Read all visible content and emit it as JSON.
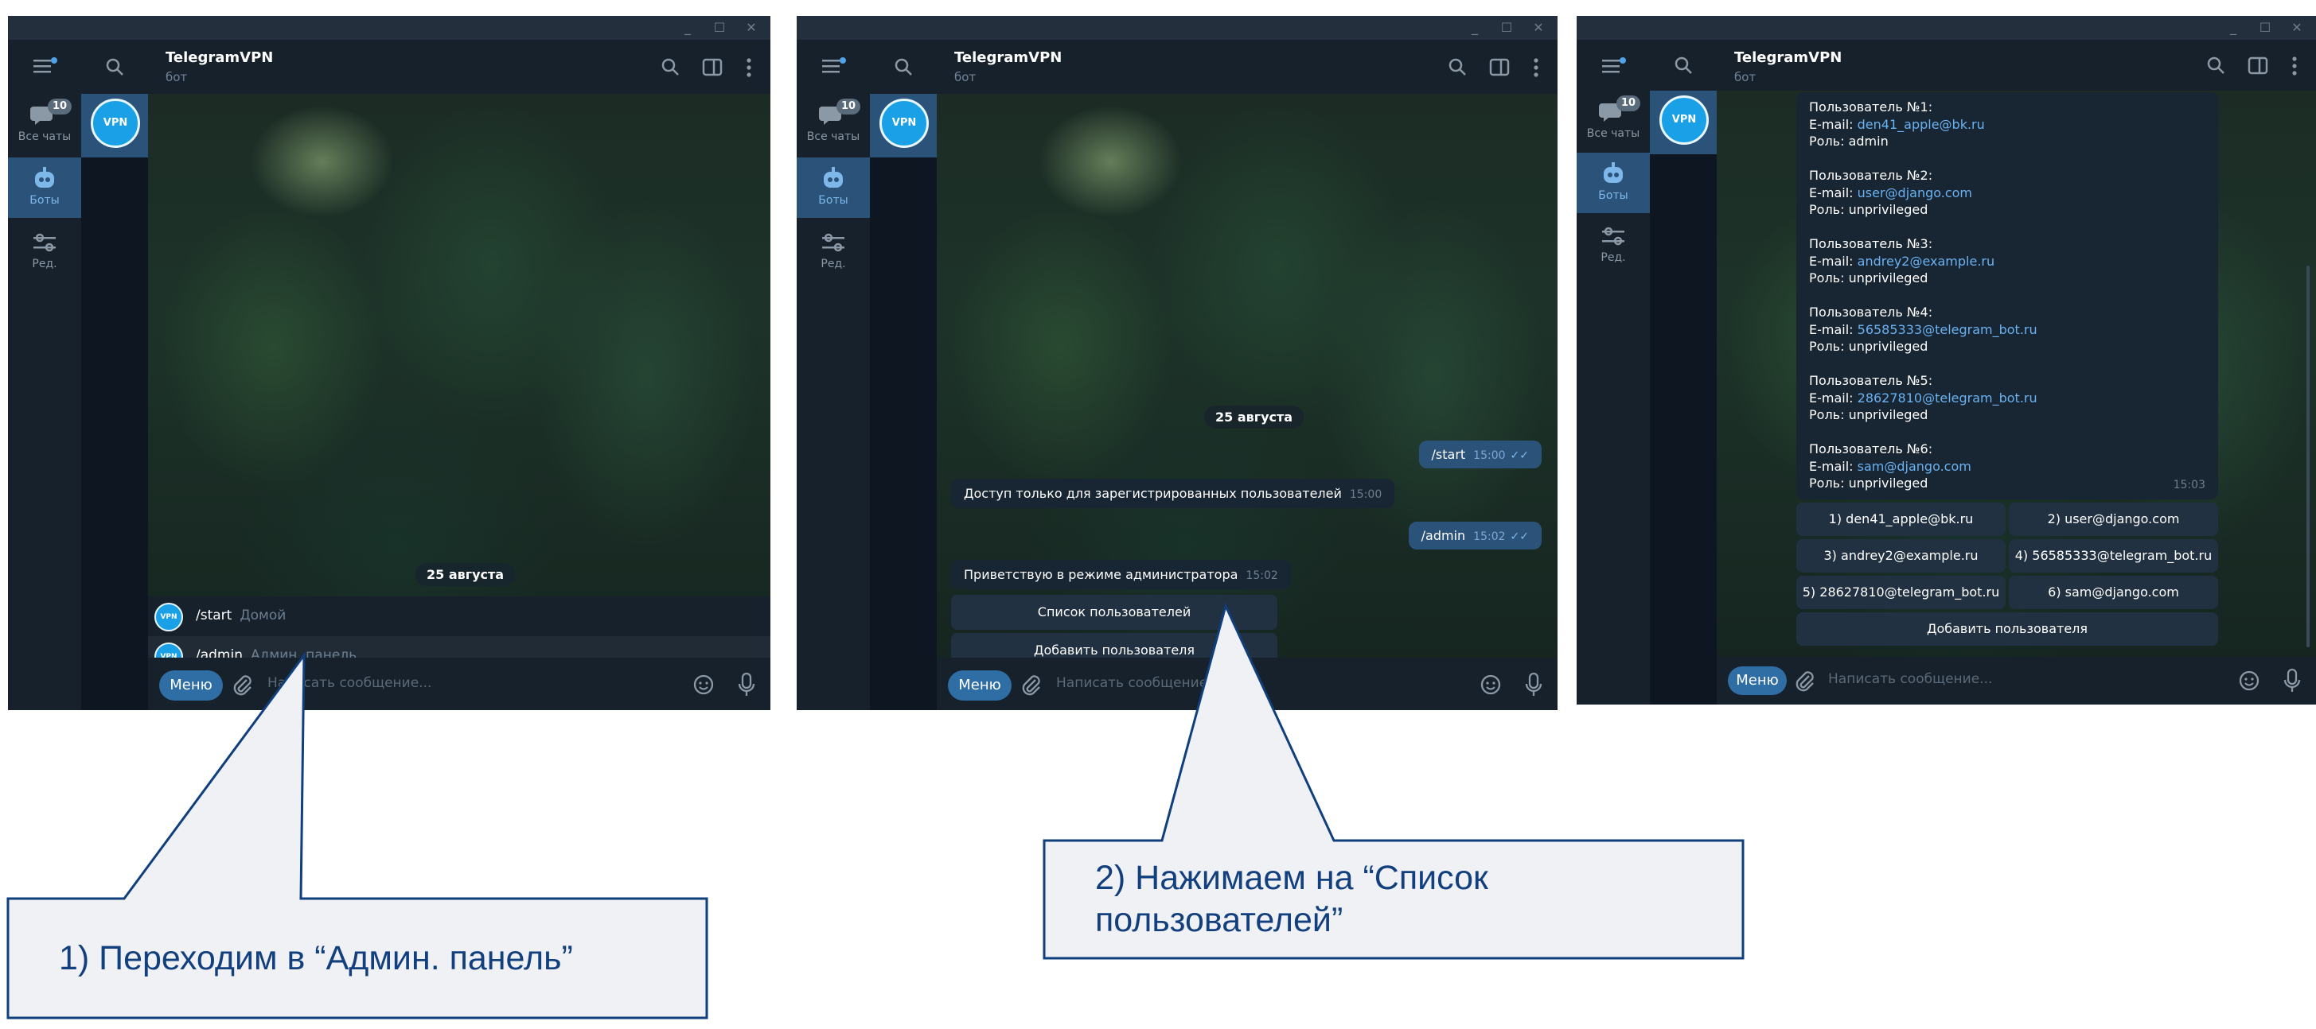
{
  "window": {
    "title": "TelegramVPN",
    "subtitle": "бот"
  },
  "rail": {
    "all_chats": "Все чаты",
    "all_chats_badge": "10",
    "bots": "Боты",
    "edit": "Ред."
  },
  "avatar_text": "VPN",
  "composer": {
    "menu": "Меню",
    "placeholder": "Написать сообщение..."
  },
  "date": "25 августа",
  "screen1": {
    "commands": [
      {
        "cmd": "/start",
        "desc": "Домой"
      },
      {
        "cmd": "/admin",
        "desc": "Админ. панель"
      }
    ]
  },
  "screen2": {
    "messages": [
      {
        "text": "/start",
        "time": "15:00"
      },
      {
        "text": "Доступ только для зарегистрированных пользователей",
        "time": "15:00"
      },
      {
        "text": "/admin",
        "time": "15:02"
      },
      {
        "text": "Приветствую в режиме администратора",
        "time": "15:02"
      }
    ],
    "buttons": [
      "Список пользователей",
      "Добавить пользователя"
    ]
  },
  "screen3": {
    "users": [
      {
        "title": "Пользователь №1:",
        "email_label": "E-mail: ",
        "email": "den41_apple@bk.ru",
        "role": "Роль: admin"
      },
      {
        "title": "Пользователь №2:",
        "email_label": "E-mail: ",
        "email": "user@django.com",
        "role": "Роль: unprivileged"
      },
      {
        "title": "Пользователь №3:",
        "email_label": "E-mail: ",
        "email": "andrey2@example.ru",
        "role": "Роль: unprivileged"
      },
      {
        "title": "Пользователь №4:",
        "email_label": "E-mail: ",
        "email": "56585333@telegram_bot.ru",
        "role": "Роль: unprivileged"
      },
      {
        "title": "Пользователь №5:",
        "email_label": "E-mail: ",
        "email": "28627810@telegram_bot.ru",
        "role": "Роль: unprivileged"
      },
      {
        "title": "Пользователь №6:",
        "email_label": "E-mail: ",
        "email": "sam@django.com",
        "role": "Роль: unprivileged"
      }
    ],
    "time": "15:03",
    "buttons": [
      "1) den41_apple@bk.ru",
      "2) user@django.com",
      "3) andrey2@example.ru",
      "4) 56585333@telegram_bot.ru",
      "5) 28627810@telegram_bot.ru",
      "6) sam@django.com"
    ],
    "add_button": "Добавить пользователя"
  },
  "callouts": {
    "step1": "1) Переходим в “Админ. панель”",
    "step2_line1": "2) Нажимаем на “Список",
    "step2_line2": "пользователей”"
  },
  "colors": {
    "accent": "#2f6ea5",
    "callout_border": "#0f3f7c",
    "callout_text": "#123f7d"
  }
}
